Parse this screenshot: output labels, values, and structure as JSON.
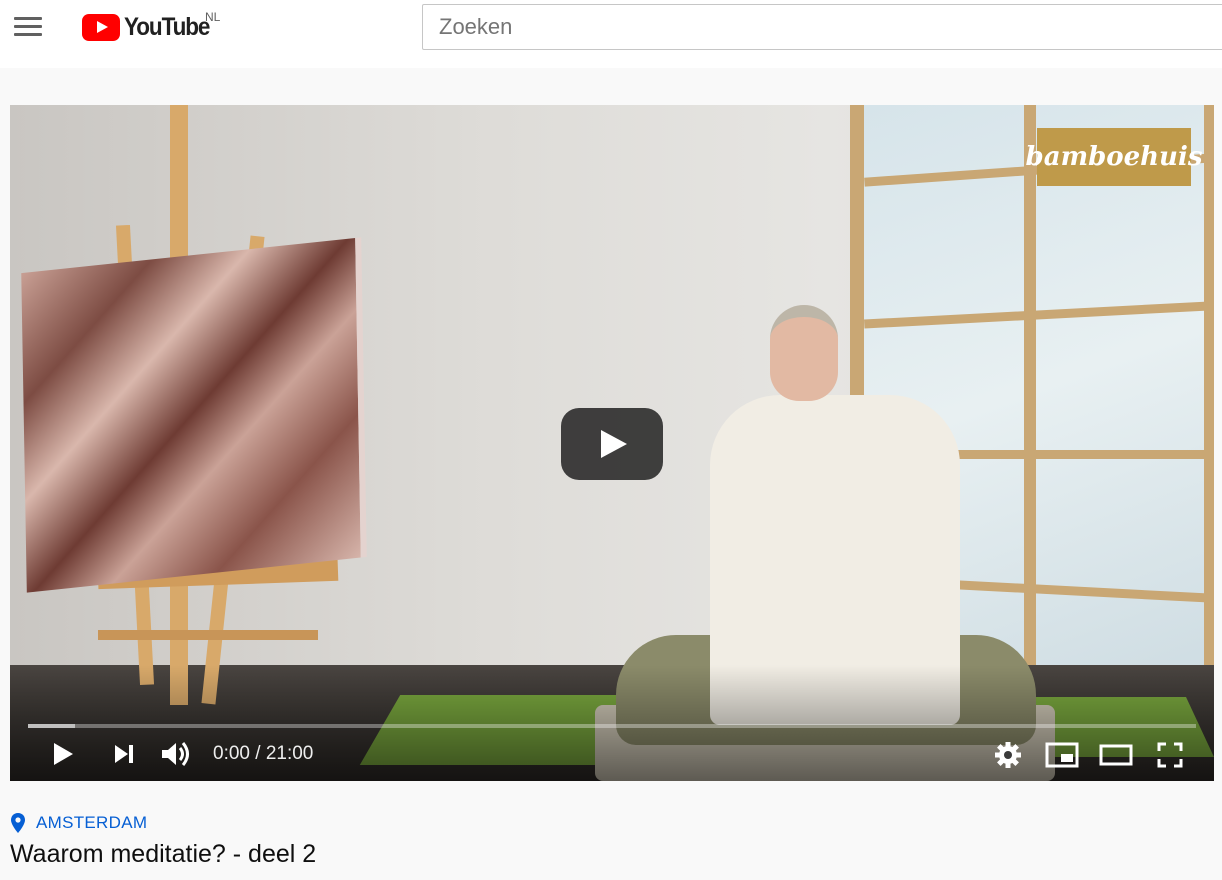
{
  "header": {
    "logo_text": "YouTube",
    "country_code": "NL",
    "search": {
      "placeholder": "Zoeken",
      "value": ""
    },
    "icons": {
      "menu": "hamburger-menu-icon",
      "logo": "youtube-logo-icon"
    }
  },
  "player": {
    "watermark": "bamboehuis",
    "current_time": "0:00",
    "duration": "21:00",
    "time_display": "0:00 / 21:00",
    "progress_fraction": 0.0,
    "loaded_fraction": 0.04,
    "controls": {
      "play": "play-icon",
      "next": "next-icon",
      "volume": "volume-icon",
      "settings": "gear-icon",
      "miniplayer": "miniplayer-icon",
      "theater": "theater-mode-icon",
      "fullscreen": "fullscreen-icon"
    }
  },
  "video": {
    "location": "AMSTERDAM",
    "title": "Waarom meditatie? - deel 2"
  },
  "colors": {
    "brand_red": "#ff0000",
    "link_blue": "#065fd4",
    "watermark_gold": "#bf9a4a"
  }
}
